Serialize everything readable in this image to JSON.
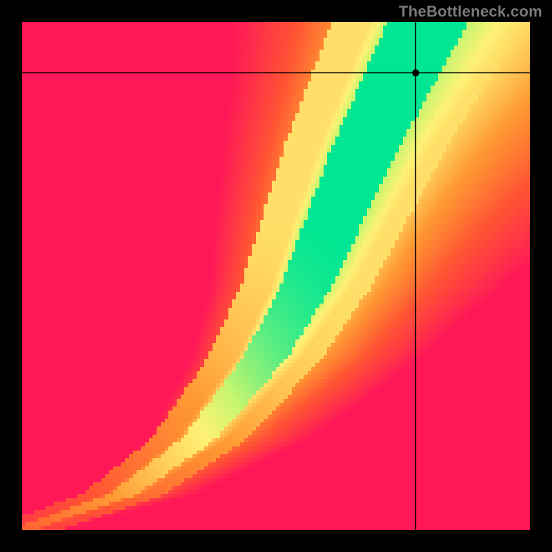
{
  "watermark": "TheBottleneck.com",
  "chart_data": {
    "type": "heatmap",
    "title": "",
    "xlabel": "",
    "ylabel": "",
    "xlim": [
      0,
      1
    ],
    "ylim": [
      0,
      1
    ],
    "grid": false,
    "legend": false,
    "resolution": 128,
    "crosshair": {
      "x": 0.775,
      "y": 0.9
    },
    "marker": {
      "x": 0.775,
      "y": 0.9,
      "radius": 5
    },
    "green_path": {
      "points": [
        [
          0.0,
          0.0
        ],
        [
          0.2,
          0.07
        ],
        [
          0.35,
          0.18
        ],
        [
          0.48,
          0.34
        ],
        [
          0.56,
          0.48
        ],
        [
          0.62,
          0.62
        ],
        [
          0.68,
          0.76
        ],
        [
          0.75,
          0.9
        ],
        [
          0.8,
          1.0
        ]
      ],
      "base_half_width": 0.04,
      "yellow_half_width": 0.105
    },
    "right_side_warmest_color_at_y": [
      [
        0.0,
        "#ff1744"
      ],
      [
        0.5,
        "#ff6f00"
      ],
      [
        0.85,
        "#ffa500"
      ],
      [
        1.0,
        "#ffd54f"
      ]
    ],
    "colors": {
      "green": "#00e693",
      "yellow": "#fff176",
      "orange": "#ff9933",
      "red_orange": "#ff5533",
      "magenta_red": "#ff1758"
    }
  }
}
